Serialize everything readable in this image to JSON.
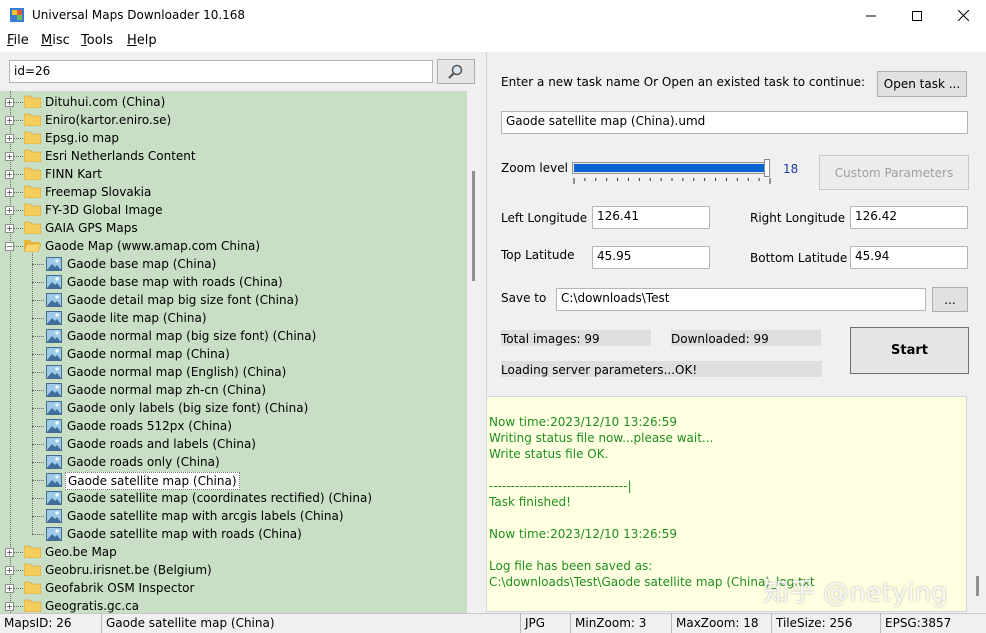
{
  "window": {
    "title": "Universal Maps Downloader 10.168",
    "controls": [
      "minimize-icon",
      "maximize-icon",
      "close-icon"
    ]
  },
  "menu": {
    "items": [
      {
        "label": "File",
        "accel": "F",
        "rest": "ile"
      },
      {
        "label": "Misc",
        "accel": "M",
        "rest": "isc"
      },
      {
        "label": "Tools",
        "accel": "T",
        "rest": "ools"
      },
      {
        "label": "Help",
        "accel": "H",
        "rest": "elp"
      }
    ]
  },
  "search": {
    "value": "id=26",
    "icon": "search-icon"
  },
  "tree": {
    "items": [
      {
        "label": "Dituhui.com (China)",
        "type": "folder",
        "expanded": false
      },
      {
        "label": "Eniro(kartor.eniro.se)",
        "type": "folder",
        "expanded": false
      },
      {
        "label": "Epsg.io map",
        "type": "folder",
        "expanded": false
      },
      {
        "label": "Esri Netherlands Content",
        "type": "folder",
        "expanded": false
      },
      {
        "label": "FINN Kart",
        "type": "folder",
        "expanded": false
      },
      {
        "label": "Freemap Slovakia",
        "type": "folder",
        "expanded": false
      },
      {
        "label": "FY-3D Global Image",
        "type": "folder",
        "expanded": false
      },
      {
        "label": "GAIA GPS Maps",
        "type": "folder",
        "expanded": false
      },
      {
        "label": "Gaode Map (www.amap.com China)",
        "type": "folder",
        "expanded": true
      },
      {
        "label": "Gaode base map (China)",
        "type": "map"
      },
      {
        "label": "Gaode base map with roads (China)",
        "type": "map"
      },
      {
        "label": "Gaode detail map big size font (China)",
        "type": "map"
      },
      {
        "label": "Gaode lite map (China)",
        "type": "map"
      },
      {
        "label": "Gaode normal map (big size font) (China)",
        "type": "map"
      },
      {
        "label": "Gaode normal map (China)",
        "type": "map"
      },
      {
        "label": "Gaode normal map (English) (China)",
        "type": "map"
      },
      {
        "label": "Gaode normal map zh-cn (China)",
        "type": "map"
      },
      {
        "label": "Gaode only labels (big size font) (China)",
        "type": "map"
      },
      {
        "label": "Gaode roads 512px (China)",
        "type": "map"
      },
      {
        "label": "Gaode roads and labels (China)",
        "type": "map"
      },
      {
        "label": "Gaode roads only (China)",
        "type": "map"
      },
      {
        "label": "Gaode satellite map (China)",
        "type": "map",
        "selected": true
      },
      {
        "label": "Gaode satellite map (coordinates rectified) (China)",
        "type": "map"
      },
      {
        "label": "Gaode satellite map with arcgis labels (China)",
        "type": "map"
      },
      {
        "label": "Gaode satellite map with roads (China)",
        "type": "map"
      },
      {
        "label": "Geo.be Map",
        "type": "folder",
        "expanded": false
      },
      {
        "label": "Geobru.irisnet.be (Belgium)",
        "type": "folder",
        "expanded": false
      },
      {
        "label": "Geofabrik OSM Inspector",
        "type": "folder",
        "expanded": false
      },
      {
        "label": "Geogratis.gc.ca",
        "type": "folder",
        "expanded": false
      }
    ]
  },
  "task": {
    "prompt": "Enter a new task name Or Open an existed task to continue:",
    "open_button": "Open task ...",
    "name_value": "Gaode satellite map (China).umd"
  },
  "zoom": {
    "label": "Zoom level",
    "value": "18",
    "level": 18,
    "max": 18
  },
  "custom_params_button": "Custom Parameters",
  "coords": {
    "left_lon_label": "Left Longitude",
    "left_lon": "126.41",
    "right_lon_label": "Right Longitude",
    "right_lon": "126.42",
    "top_lat_label": "Top Latitude",
    "top_lat": "45.95",
    "bottom_lat_label": "Bottom Latitude",
    "bottom_lat": "45.94"
  },
  "save": {
    "label": "Save to",
    "path": "C:\\downloads\\Test",
    "browse_button": "..."
  },
  "stats": {
    "total": "Total images: 99",
    "downloaded": "Downloaded: 99",
    "loading": "Loading server parameters...OK!"
  },
  "start_button": "Start",
  "log": {
    "lines": [
      "Now time:2023/12/10 13:26:59",
      "Writing status file now...please wait...",
      "Write status file OK.",
      "",
      "--------------------------------|",
      "Task finished!",
      "",
      "Now time:2023/12/10 13:26:59",
      "",
      "Log file has been saved as:",
      "C:\\downloads\\Test\\Gaode satellite map (China)_log.txt"
    ],
    "watermark": "知乎 @netying"
  },
  "statusbar": {
    "mapsid": "MapsID: 26",
    "name": "Gaode satellite map (China)",
    "format": "JPG",
    "minzoom": "MinZoom: 3",
    "maxzoom": "MaxZoom: 18",
    "tilesize": "TileSize: 256",
    "epsg": "EPSG:3857"
  },
  "colors": {
    "tree_bg": "#c9dfc5",
    "log_bg": "#ffffe1",
    "log_text": "#1f8f1f",
    "zoom_fill": "#0a64d3"
  }
}
